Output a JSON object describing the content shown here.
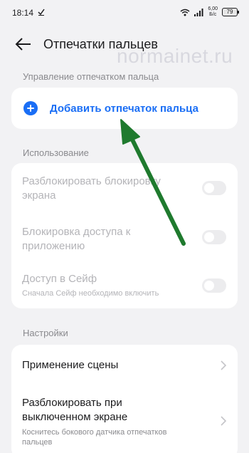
{
  "status_bar": {
    "time": "18:14",
    "net_speed_value": "6,00",
    "net_speed_unit": "Б/с",
    "battery": "79"
  },
  "header": {
    "title": "Отпечатки пальцев"
  },
  "watermark": "normainet.ru",
  "sections": {
    "manage_label": "Управление отпечатком пальца",
    "add_fingerprint_label": "Добавить отпечаток пальца",
    "usage_label": "Использование",
    "settings_label": "Настройки"
  },
  "usage_items": [
    {
      "title_line1": "Разблокировать блокировку",
      "title_line2": "экрана",
      "enabled": false
    },
    {
      "title_line1": "Блокировка доступа к",
      "title_line2": "приложению",
      "enabled": false
    },
    {
      "title_line1": "Доступ в Сейф",
      "subtitle": "Сначала Сейф необходимо включить",
      "enabled": false
    }
  ],
  "settings_items": [
    {
      "title": "Применение сцены"
    },
    {
      "title_line1": "Разблокировать при",
      "title_line2": "выключенном экране",
      "subtitle_line1": "Коснитесь бокового датчика отпечатков",
      "subtitle_line2": "пальцев"
    }
  ],
  "colors": {
    "accent": "#1a6ef5",
    "arrow": "#1f7a2e",
    "background": "#f2f2f4"
  }
}
